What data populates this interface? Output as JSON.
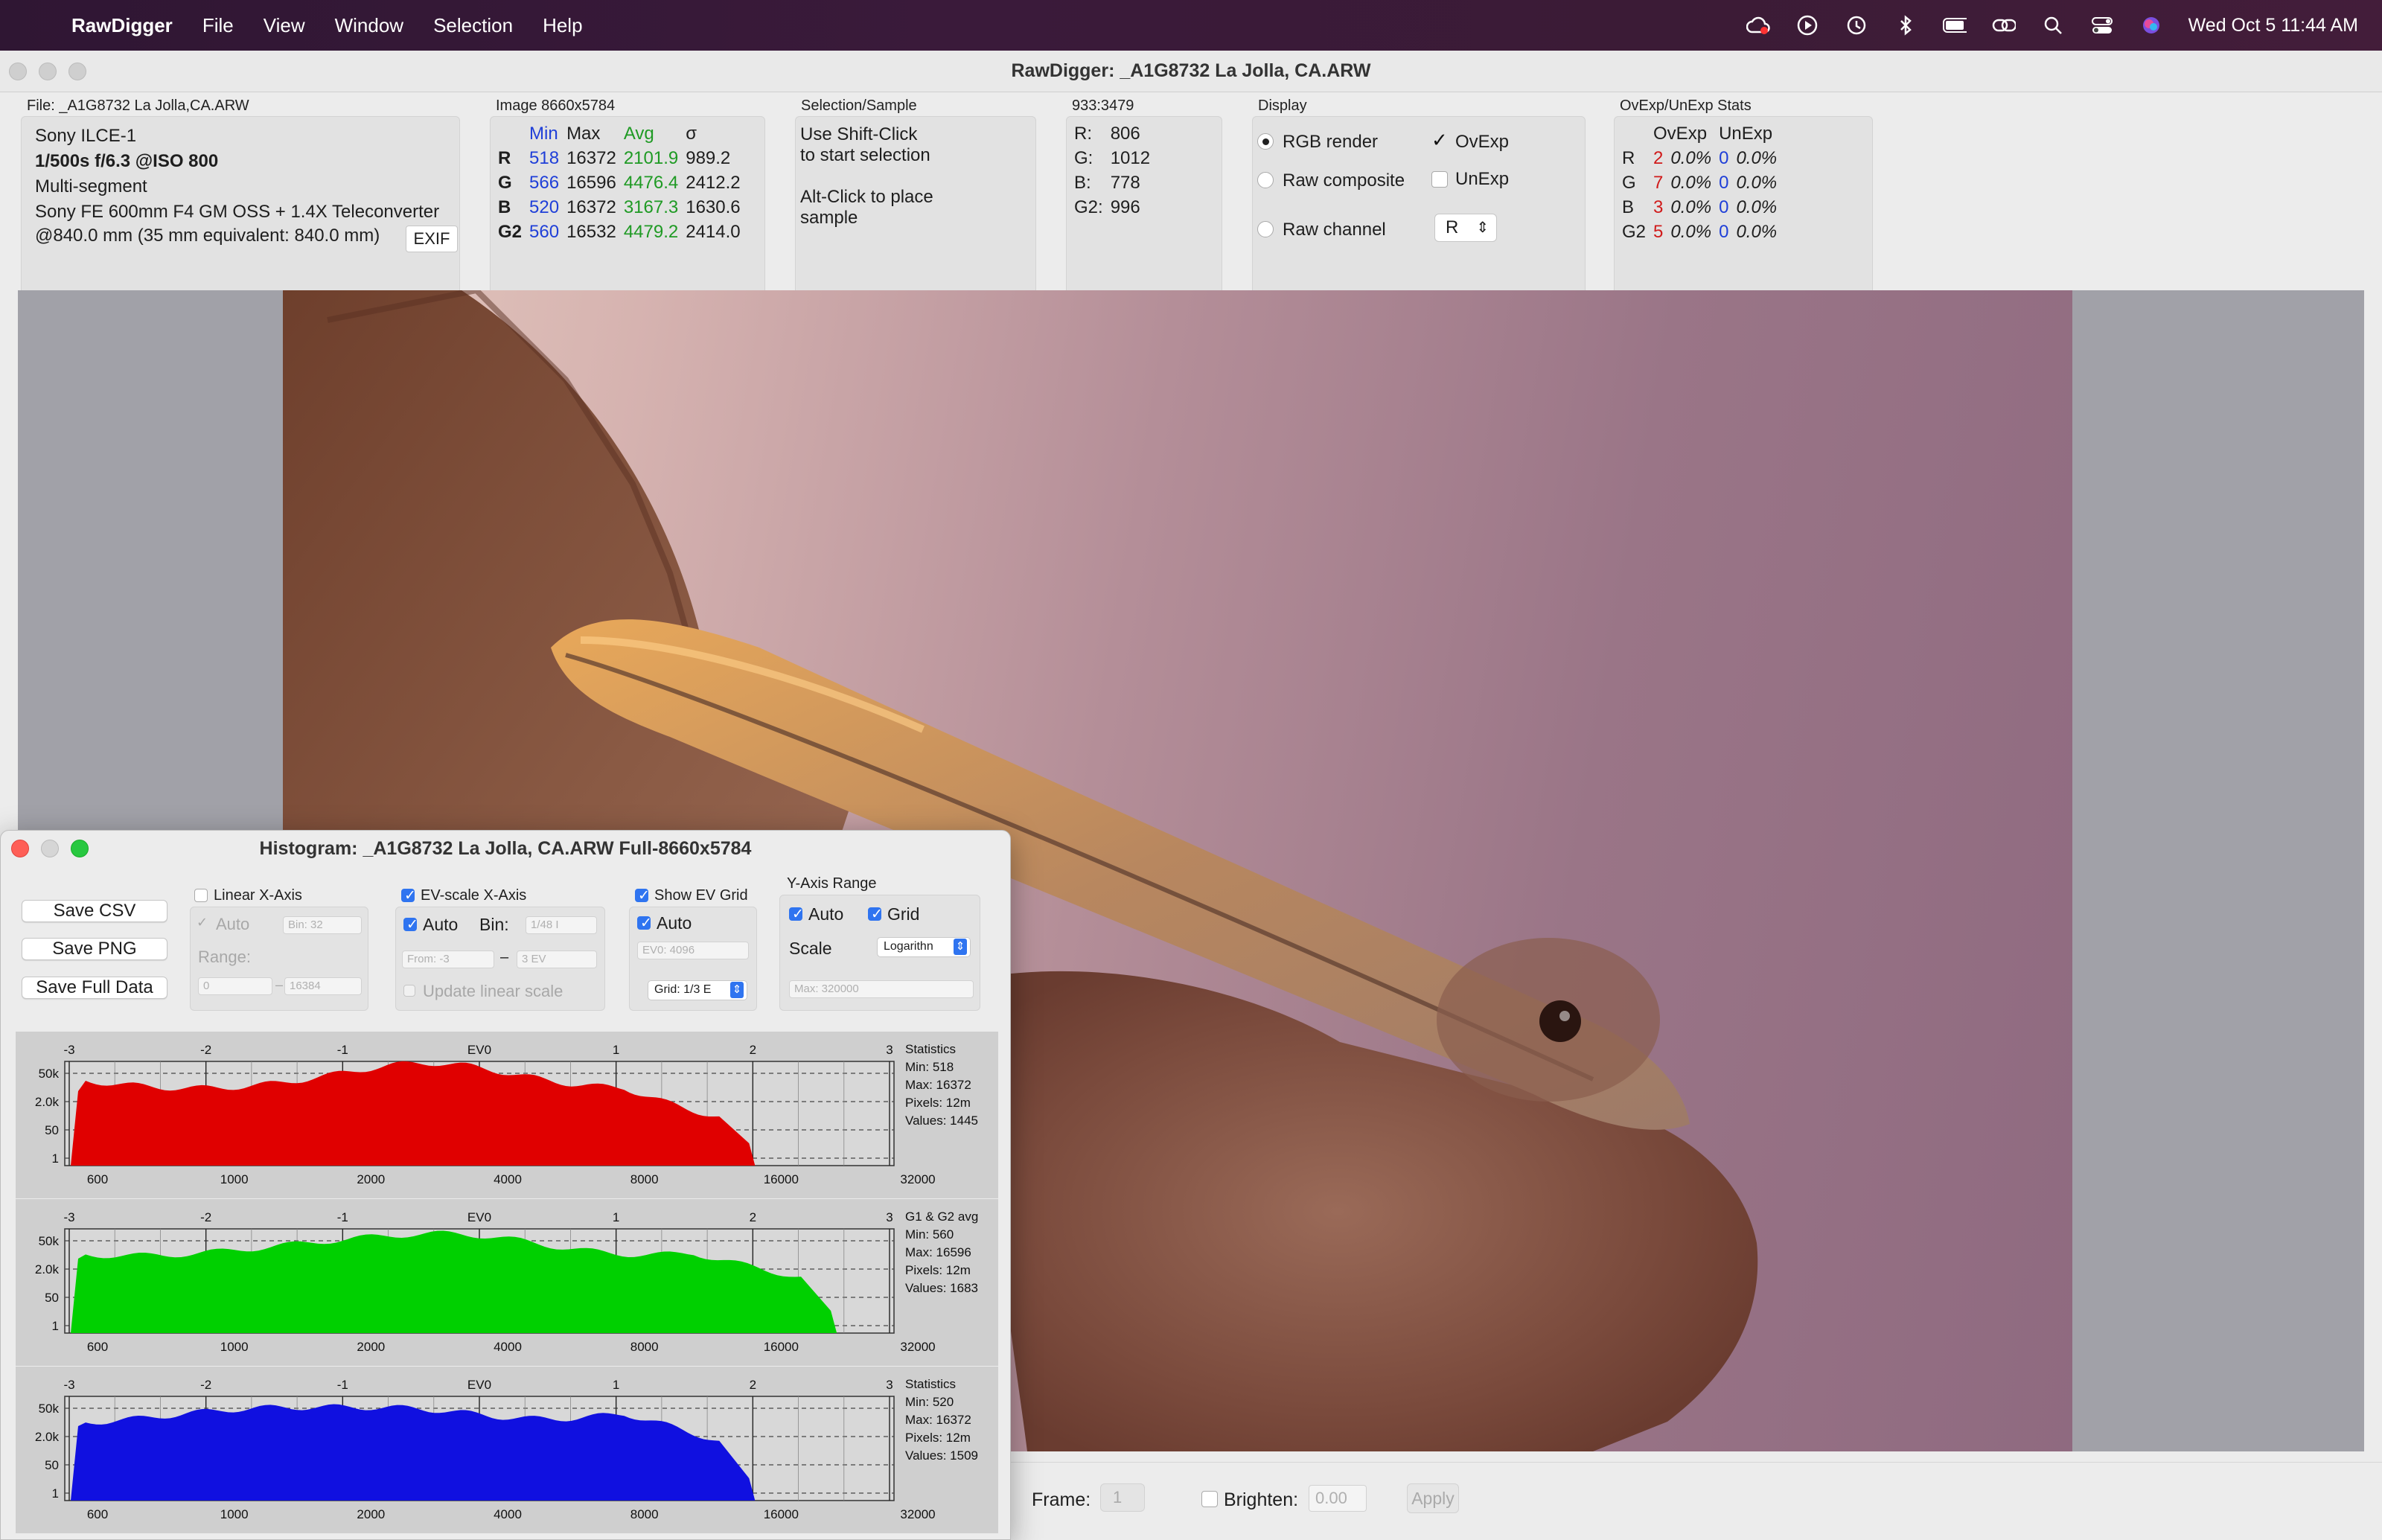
{
  "menubar": {
    "app_name": "RawDigger",
    "items": [
      "File",
      "View",
      "Window",
      "Selection",
      "Help"
    ],
    "clock": "Wed Oct 5  11:44 AM"
  },
  "window": {
    "title": "RawDigger: _A1G8732 La Jolla, CA.ARW"
  },
  "file_panel": {
    "label": "File: _A1G8732 La Jolla,CA.ARW",
    "camera": "Sony ILCE-1",
    "exposure": "1/500s f/6.3 @ISO 800",
    "metering": "Multi-segment",
    "lens": "Sony FE 600mm F4 GM OSS + 1.4X Teleconverter",
    "focal": "@840.0 mm (35 mm equivalent: 840.0 mm)",
    "exif_button": "EXIF"
  },
  "image_panel": {
    "label": "Image 8660x5784",
    "headers": [
      "",
      "Min",
      "Max",
      "Avg",
      "σ"
    ],
    "rows": [
      [
        "R",
        "518",
        "16372",
        "2101.9",
        "989.2"
      ],
      [
        "G",
        "566",
        "16596",
        "4476.4",
        "2412.2"
      ],
      [
        "B",
        "520",
        "16372",
        "3167.3",
        "1630.6"
      ],
      [
        "G2",
        "560",
        "16532",
        "4479.2",
        "2414.0"
      ]
    ]
  },
  "selection_panel": {
    "label": "Selection/Sample",
    "line1": "Use Shift-Click",
    "line2": "to start selection",
    "line3": "Alt-Click to place",
    "line4": "sample"
  },
  "sample_panel": {
    "label": "933:3479",
    "rows": [
      [
        "R:",
        "806"
      ],
      [
        "G:",
        "1012"
      ],
      [
        "B:",
        "778"
      ],
      [
        "G2:",
        "996"
      ]
    ]
  },
  "display_panel": {
    "label": "Display",
    "rgb_render": "RGB render",
    "raw_composite": "Raw composite",
    "raw_channel": "Raw channel",
    "ovexp": "OvExp",
    "unexp": "UnExp",
    "channel_select": "R"
  },
  "ovexp_panel": {
    "label": "OvExp/UnExp Stats",
    "headers": [
      "",
      "OvExp",
      "",
      "UnExp",
      ""
    ],
    "rows": [
      [
        "R",
        "2",
        "0.0%",
        "0",
        "0.0%"
      ],
      [
        "G",
        "7",
        "0.0%",
        "0",
        "0.0%"
      ],
      [
        "B",
        "3",
        "0.0%",
        "0",
        "0.0%"
      ],
      [
        "G2",
        "5",
        "0.0%",
        "0",
        "0.0%"
      ]
    ]
  },
  "bottombar": {
    "frame_label": "Frame:",
    "frame_value": "1",
    "brighten_label": "Brighten:",
    "brighten_value": "0.00",
    "apply": "Apply"
  },
  "histogram": {
    "title": "Histogram: _A1G8732 La Jolla, CA.ARW Full-8660x5784",
    "save_csv": "Save CSV",
    "save_png": "Save PNG",
    "save_full": "Save Full Data",
    "linear_x": "Linear X-Axis",
    "auto": "Auto",
    "bin_32": "Bin: 32",
    "range": "Range:",
    "range_from": "0",
    "range_to": "16384",
    "ev_scale": "EV-scale X-Axis",
    "bin": "Bin:",
    "bin_sel": "1/48 I",
    "from": "From: -3",
    "to": "3 EV",
    "update_linear": "Update linear scale",
    "show_ev_grid": "Show EV Grid",
    "ev0": "EV0: 4096",
    "grid_sel": "Grid: 1/3 E",
    "y_range": "Y-Axis Range",
    "grid": "Grid",
    "scale": "Scale",
    "scale_sel": "Logarithn",
    "max": "Max: 320000",
    "ev_ticks": [
      "-3",
      "-2",
      "-1",
      "EV0",
      "1",
      "2",
      "3"
    ],
    "x_ticks": [
      "600",
      "1000",
      "2000",
      "4000",
      "8000",
      "16000",
      "32000"
    ],
    "y_ticks": [
      "50k",
      "2.0k",
      "50",
      "1"
    ],
    "colors": {
      "R": "#e00000",
      "G": "#00d000",
      "B": "#1010e0"
    },
    "stats_R": {
      "title": "Statistics",
      "min": "Min: 518",
      "max": "Max: 16372",
      "pixels": "Pixels: 12m",
      "values": "Values: 1445"
    },
    "stats_G": {
      "title": "G1 & G2 avg",
      "min": "Min: 560",
      "max": "Max: 16596",
      "pixels": "Pixels: 12m",
      "values": "Values: 1683"
    },
    "stats_B": {
      "title": "Statistics",
      "min": "Min: 520",
      "max": "Max: 16372",
      "pixels": "Pixels: 12m",
      "values": "Values: 1509"
    }
  }
}
